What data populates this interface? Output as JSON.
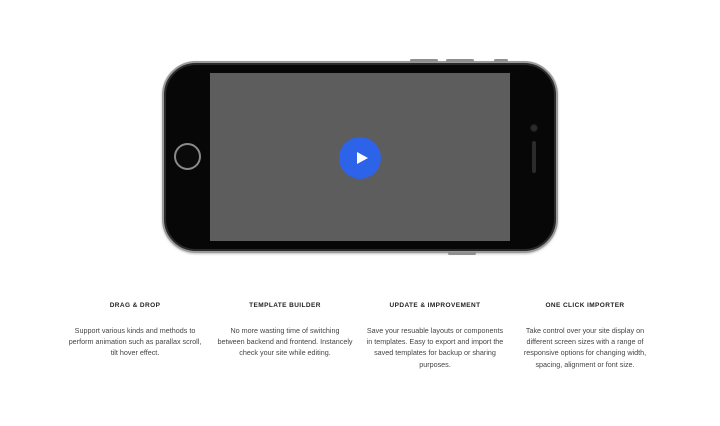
{
  "colors": {
    "play_button": "#2d63e8",
    "screen": "#5d5d5d",
    "phone_body": "#070707"
  },
  "video": {
    "play_icon": "play-icon"
  },
  "features": [
    {
      "title": "DRAG & DROP",
      "description": "Support various kinds and methods to perform animation such as parallax scroll, tilt hover effect."
    },
    {
      "title": "TEMPLATE BUILDER",
      "description": "No more wasting time of switching between backend and frontend. Instancely check your site while editing."
    },
    {
      "title": "UPDATE & IMPROVEMENT",
      "description": "Save your resuable layouts or components in templates. Easy to export and import the saved templates for backup or sharing purposes."
    },
    {
      "title": "ONE CLICK IMPORTER",
      "description": "Take control over your site display on different screen sizes with a range of responsive options for changing width, spacing, alignment or font size."
    }
  ]
}
